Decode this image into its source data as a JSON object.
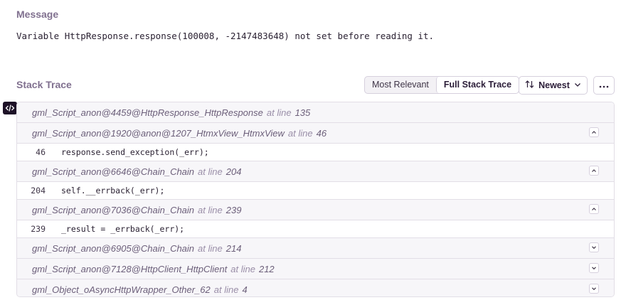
{
  "message": {
    "title": "Message",
    "text": "Variable HttpResponse.response(100008, -2147483648) not set before reading it."
  },
  "stack": {
    "title": "Stack Trace",
    "tabs": {
      "most_relevant": "Most Relevant",
      "full": "Full Stack Trace"
    },
    "sort_label": "Newest",
    "sort_icon": "sort-arrows-icon",
    "more_icon": "ellipsis-icon",
    "at_line_text": "at line",
    "frames": [
      {
        "name": "gml_Script_anon@4459@HttpResponse_HttpResponse",
        "line": "135"
      },
      {
        "name": "gml_Script_anon@1920@anon@1207_HtmxView_HtmxView",
        "line": "46",
        "code_line": "46",
        "code": "response.send_exception(_err);"
      },
      {
        "name": "gml_Script_anon@6646@Chain_Chain",
        "line": "204",
        "code_line": "204",
        "code": "self.__errback(_err);"
      },
      {
        "name": "gml_Script_anon@7036@Chain_Chain",
        "line": "239",
        "code_line": "239",
        "code": "_result = _errback(_err);"
      },
      {
        "name": "gml_Script_anon@6905@Chain_Chain",
        "line": "214"
      },
      {
        "name": "gml_Script_anon@7128@HttpClient_HttpClient",
        "line": "212"
      },
      {
        "name": "gml_Object_oAsyncHttpWrapper_Other_62",
        "line": "4"
      }
    ]
  }
}
